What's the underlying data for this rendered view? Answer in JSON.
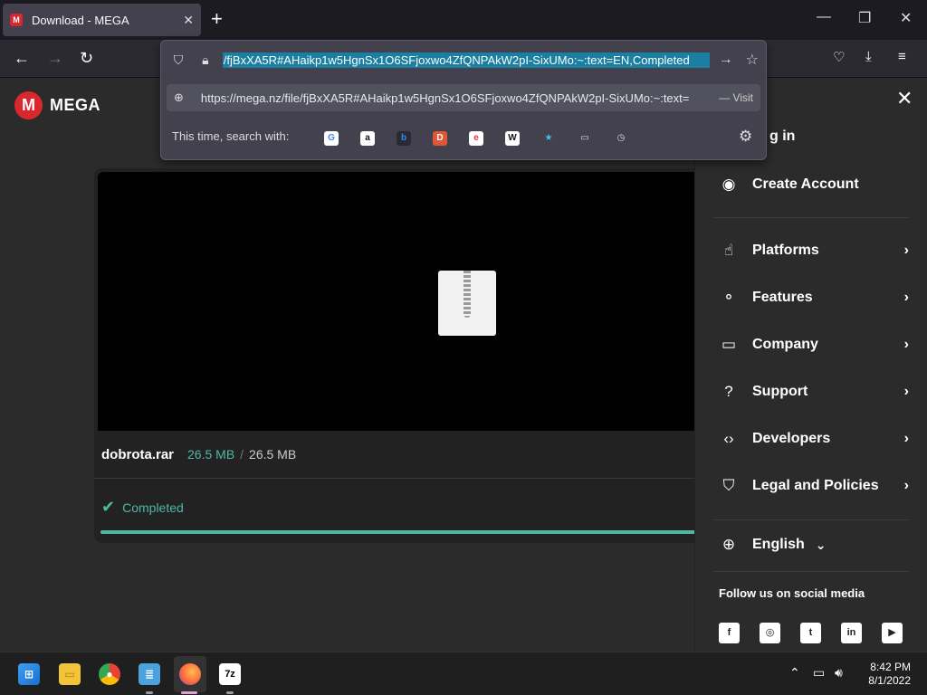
{
  "browser": {
    "tab_title": "Download - MEGA",
    "tab_favicon": "M",
    "new_tab_symbol": "+",
    "minimize": "—",
    "maximize": "❐",
    "close": "✕",
    "back": "←",
    "forward": "→",
    "reload": "↻"
  },
  "urlbar": {
    "selected_text": "/fjBxXA5R#AHaikp1w5HgnSx1O6SFjoxwo4ZfQNPAkW2pI-SixUMo:~:text=EN,Completed",
    "suggestion_url": "https://mega.nz/file/fjBxXA5R#AHaikp1w5HgnSx1O6SFjoxwo4ZfQNPAkW2pI-SixUMo:~:text=",
    "suggestion_action": "— Visit",
    "search_with_label": "This time, search with:",
    "engines": [
      {
        "name": "google",
        "glyph": "G",
        "bg": "#ffffff",
        "fg": "#4285f4"
      },
      {
        "name": "amazon",
        "glyph": "a",
        "bg": "#ffffff",
        "fg": "#111111"
      },
      {
        "name": "bing",
        "glyph": "b",
        "bg": "#2b2a33",
        "fg": "#1e90ff"
      },
      {
        "name": "duckduckgo",
        "glyph": "D",
        "bg": "#de5833",
        "fg": "#ffffff"
      },
      {
        "name": "ebay",
        "glyph": "e",
        "bg": "#ffffff",
        "fg": "#e53238"
      },
      {
        "name": "wikipedia",
        "glyph": "W",
        "bg": "#ffffff",
        "fg": "#111111"
      },
      {
        "name": "bookmarks",
        "glyph": "★",
        "bg": "transparent",
        "fg": "#3fc0f0"
      },
      {
        "name": "tabs",
        "glyph": "▭",
        "bg": "transparent",
        "fg": "#dddddd"
      },
      {
        "name": "history",
        "glyph": "◷",
        "bg": "transparent",
        "fg": "#dddddd"
      }
    ]
  },
  "mega": {
    "logo_letter": "M",
    "logo_word": "MEGA",
    "file_name": "dobrota.rar",
    "downloaded": "26.5 MB",
    "separator": "/",
    "total": "26.5 MB",
    "status": "Completed",
    "progress": 1.0,
    "accent": "#4eb8a5",
    "brand": "#d9272e"
  },
  "menu": {
    "close": "✕",
    "login": "g in",
    "items": [
      {
        "label": "Create Account",
        "icon": "user-circle-icon",
        "glyph": "◉",
        "chevron": ""
      },
      {
        "label": "Platforms",
        "icon": "touch-icon",
        "glyph": "☝",
        "chevron": "›"
      },
      {
        "label": "Features",
        "icon": "nodes-icon",
        "glyph": "⚬",
        "chevron": "›"
      },
      {
        "label": "Company",
        "icon": "briefcase-icon",
        "glyph": "▭",
        "chevron": "›"
      },
      {
        "label": "Support",
        "icon": "help-icon",
        "glyph": "?",
        "chevron": "›"
      },
      {
        "label": "Developers",
        "icon": "code-icon",
        "glyph": "‹›",
        "chevron": "›"
      },
      {
        "label": "Legal and Policies",
        "icon": "shield-icon",
        "glyph": "⛉",
        "chevron": "›"
      }
    ],
    "language": "English",
    "language_chevron": "⌄",
    "follow": "Follow us on social media",
    "socials": [
      {
        "name": "facebook",
        "glyph": "f"
      },
      {
        "name": "instagram",
        "glyph": "◎"
      },
      {
        "name": "twitter",
        "glyph": "t"
      },
      {
        "name": "linkedin",
        "glyph": "in"
      },
      {
        "name": "youtube",
        "glyph": "▶"
      }
    ]
  },
  "taskbar": {
    "time": "8:42 PM",
    "date": "8/1/2022",
    "sevenzip": "7z"
  }
}
